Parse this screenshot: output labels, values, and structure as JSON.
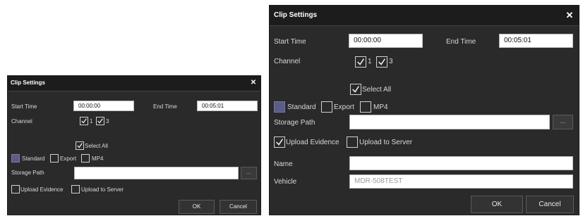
{
  "dialog": {
    "title": "Clip Settings",
    "close_glyph": "✕",
    "start_time_label": "Start Time",
    "start_time_value": "00:00:00",
    "end_time_label": "End Time",
    "end_time_value": "00:05:01",
    "channel_label": "Channel",
    "channels": [
      {
        "label": "1",
        "checked": true
      },
      {
        "label": "3",
        "checked": true
      }
    ],
    "select_all_label": "Select All",
    "format_options": [
      {
        "label": "Standard",
        "checked": true
      },
      {
        "label": "Export",
        "checked": false
      },
      {
        "label": "MP4",
        "checked": false
      }
    ],
    "storage_path_label": "Storage Path",
    "storage_path_value": "",
    "browse_label": "...",
    "upload_evidence_label": "Upload Evidence",
    "upload_to_server_label": "Upload to Server",
    "name_label": "Name",
    "name_value": "",
    "vehicle_label": "Vehicle",
    "vehicle_value": "MDR-508TEST",
    "ok_label": "OK",
    "cancel_label": "Cancel"
  },
  "colors": {
    "dialog_bg": "#2a2a2a",
    "titlebar_bg": "#1c1c1c",
    "standard_fill": "#5c5c8a"
  },
  "icons": {
    "close": "close-icon",
    "check": "check-icon",
    "browse": "ellipsis-icon"
  }
}
